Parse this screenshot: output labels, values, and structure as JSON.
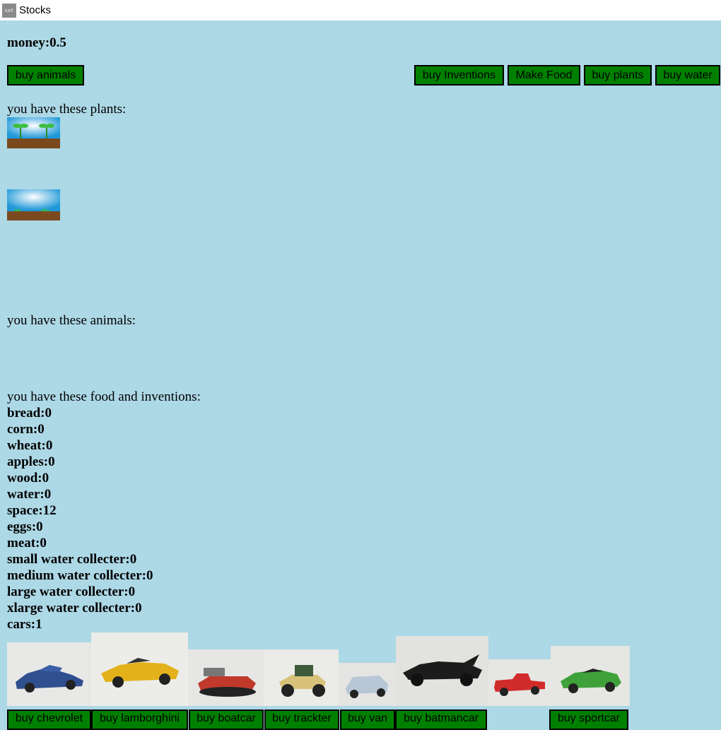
{
  "window": {
    "title": "Stocks",
    "icon": "app-icon"
  },
  "money": "money:0.5",
  "buttons": {
    "buy_animals": "buy animals",
    "buy_inventions": "buy Inventions",
    "make_food": "Make Food",
    "buy_plants": "buy plants",
    "buy_water": "buy water"
  },
  "labels": {
    "plants": "you have these plants:",
    "animals": "you have these animals:",
    "food_inventions": "you have these food and inventions:"
  },
  "inventory": [
    "bread:0",
    "corn:0",
    "wheat:0",
    "apples:0",
    "wood:0",
    "water:0",
    "space:12",
    "eggs:0",
    "meat:0",
    "small water collecter:0",
    "medium water collecter:0",
    "large water collecter:0",
    "xlarge water collecter:0",
    "cars:1"
  ],
  "car_buttons": [
    "buy chevrolet",
    "buy lamborghini",
    "buy boatcar",
    "buy trackter",
    "buy van",
    "buy batmancar",
    "buy sportcar"
  ],
  "colors": {
    "background": "#add8e6",
    "button": "#008000"
  }
}
